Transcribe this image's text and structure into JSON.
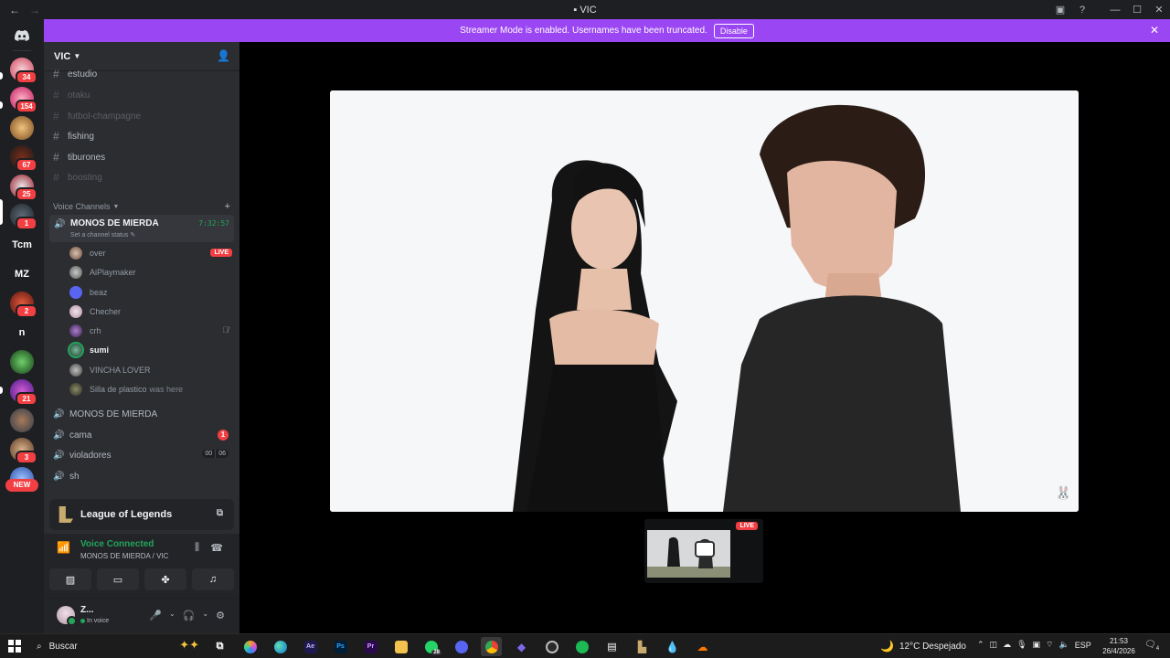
{
  "window": {
    "title": "VIC"
  },
  "banner": {
    "text": "Streamer Mode is enabled. Usernames have been truncated.",
    "button": "Disable"
  },
  "servers": {
    "badges": [
      "34",
      "154",
      "67",
      "25",
      "1",
      "2",
      "21",
      "3"
    ],
    "text_servers": [
      "Tcm",
      "MZ",
      "n"
    ],
    "new_label": "NEW"
  },
  "guild": {
    "name": "VIC"
  },
  "text_channels": [
    {
      "name": "estudio",
      "muted": false
    },
    {
      "name": "otaku",
      "muted": true
    },
    {
      "name": "futbol-champagne",
      "muted": true
    },
    {
      "name": "fishing",
      "muted": false
    },
    {
      "name": "tiburones",
      "muted": false
    },
    {
      "name": "boosting",
      "muted": true
    }
  ],
  "voice_section": {
    "title": "Voice Channels",
    "active": {
      "name": "MONOS DE MIERDA",
      "timer": "7:32:57",
      "status": "Set a channel status"
    }
  },
  "members": [
    {
      "name": "over",
      "live": "LIVE"
    },
    {
      "name": "AiPlaymaker"
    },
    {
      "name": "beaz"
    },
    {
      "name": "Checher"
    },
    {
      "name": "crh"
    },
    {
      "name": "sumi"
    },
    {
      "name": "VINCHA LOVER"
    },
    {
      "name": "Silla de plastico",
      "suffix": "was here"
    }
  ],
  "voice_channels": [
    {
      "name": "MONOS DE MIERDA"
    },
    {
      "name": "cama",
      "badge": "1"
    },
    {
      "name": "violadores",
      "pair": [
        "00",
        "06"
      ]
    },
    {
      "name": "sh"
    }
  ],
  "activity": {
    "game": "League of Legends"
  },
  "voice_panel": {
    "title": "Voice Connected",
    "subtitle": "MONOS DE MIERDA / VIC"
  },
  "user": {
    "name": "Z...",
    "status": "In voice"
  },
  "stage": {
    "thumb_live": "LIVE"
  },
  "taskbar": {
    "search_placeholder": "Buscar",
    "whatsapp_count": "28",
    "weather": "12°C  Despejado",
    "lang": "ESP",
    "time": "21:53",
    "date": "26/4/2026",
    "notif_count": "4"
  },
  "colors": {
    "accent": "#9b46f3",
    "online": "#23a55a",
    "danger": "#f23f43",
    "sidebar": "#2b2d31",
    "rail": "#1e1f22"
  }
}
